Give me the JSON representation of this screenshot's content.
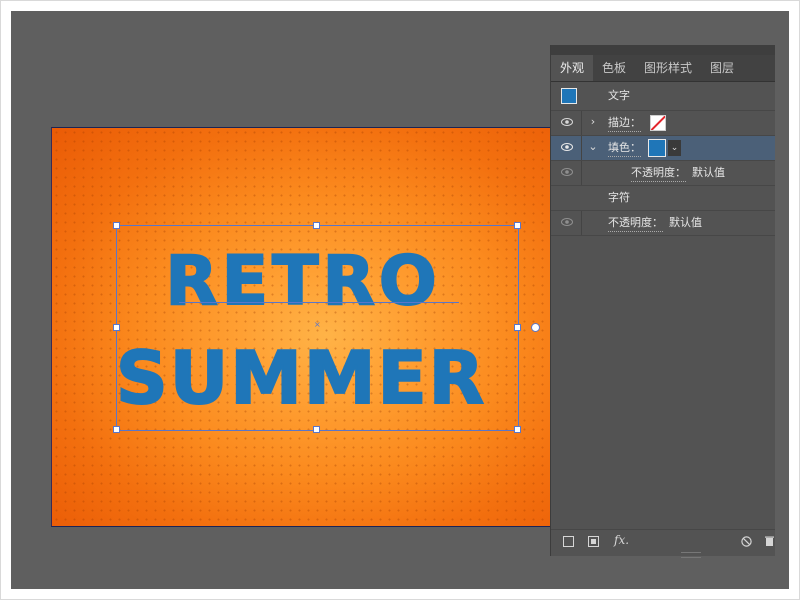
{
  "artwork": {
    "line1": "RETRO",
    "line2": "SUMMER",
    "text_color": "#1f76b8"
  },
  "panel": {
    "tabs": [
      "外观",
      "色板",
      "图形样式",
      "图层"
    ],
    "object_title": "文字",
    "stroke_label": "描边：",
    "fill_label": "填色：",
    "fill_opacity_label": "不透明度：",
    "fill_opacity_value": "默认值",
    "characters_label": "字符",
    "opacity_label": "不透明度：",
    "opacity_value": "默认值",
    "fill_color": "#1f76b8",
    "icons": [
      "new-art-icon",
      "clear-appearance-icon",
      "fx-icon",
      "no-icon",
      "delete-icon"
    ]
  }
}
